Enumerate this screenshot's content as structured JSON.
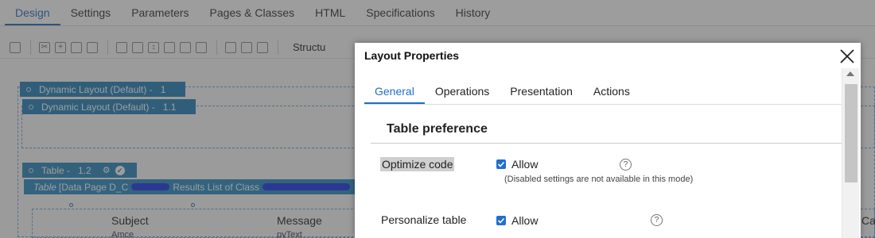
{
  "main_tabs": [
    "Design",
    "Settings",
    "Parameters",
    "Pages & Classes",
    "HTML",
    "Specifications",
    "History"
  ],
  "toolbar": {
    "structure_label": "Structu"
  },
  "canvas": {
    "layout1": {
      "label": "Dynamic Layout (Default) -",
      "index": "1"
    },
    "layout2": {
      "label": "Dynamic Layout (Default) -",
      "index": "1.1"
    },
    "table": {
      "label": "Table -",
      "index": "1.2"
    },
    "table_bar": {
      "prefix": "Table",
      "source": "[Data Page D_C",
      "mid": "Results List of Class"
    },
    "columns": [
      "Subject",
      "Message"
    ],
    "cells": [
      "Amce",
      "pyText"
    ],
    "right_col_fragment": "Cas"
  },
  "modal": {
    "title": "Layout Properties",
    "tabs": [
      "General",
      "Operations",
      "Presentation",
      "Actions"
    ],
    "section": "Table preference",
    "rows": [
      {
        "label": "Optimize code",
        "check_label": "Allow",
        "checked": true,
        "note": "(Disabled settings are not available in this mode)"
      },
      {
        "label": "Personalize table",
        "check_label": "Allow",
        "checked": true
      }
    ],
    "help_glyph": "?"
  },
  "colors": {
    "accent": "#1f6fbf",
    "layout_blue": "#2480b8",
    "checkbox": "#1f6fd1"
  }
}
